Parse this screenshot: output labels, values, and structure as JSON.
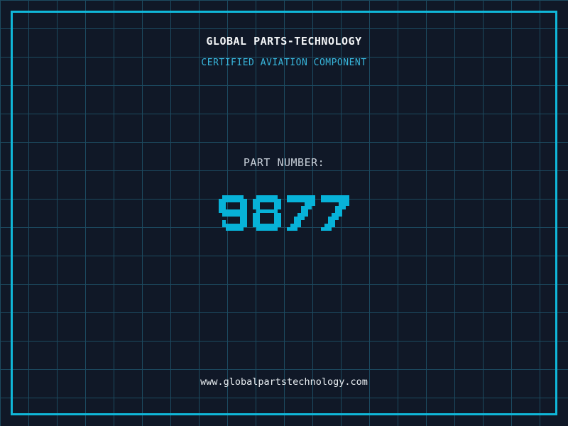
{
  "colors": {
    "background": "#101827",
    "grid_line": "#1c4a60",
    "frame_cyan": "#10b7d9",
    "accent_cyan": "#07b2d8",
    "subtitle_cyan": "#38b6dc",
    "title_white": "#f4f6f8",
    "label_gray": "#c7cfd8",
    "url_white": "#e9eef2"
  },
  "header": {
    "title": "GLOBAL PARTS-TECHNOLOGY",
    "subtitle": "CERTIFIED AVIATION COMPONENT"
  },
  "part": {
    "label": "PART NUMBER:",
    "value": "9877"
  },
  "footer": {
    "url": "www.globalpartstechnology.com"
  }
}
